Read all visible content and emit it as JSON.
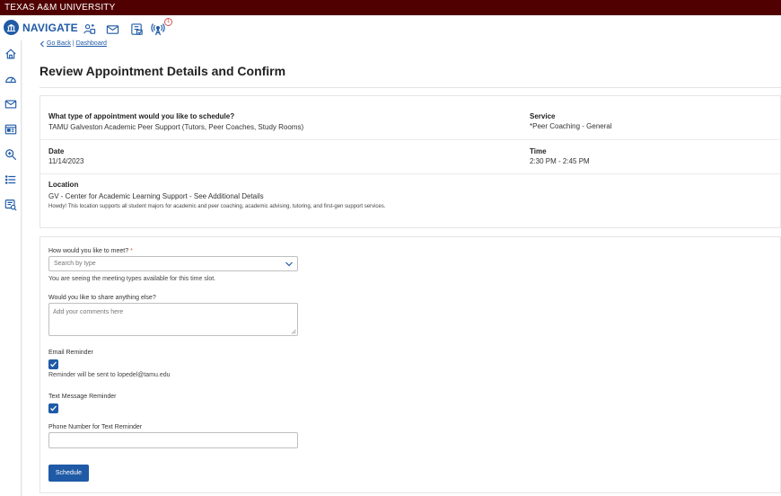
{
  "header": {
    "university": "TEXAS A&M UNIVERSITY",
    "app_name": "NAVIGATE",
    "notification_count": "1"
  },
  "breadcrumb": {
    "back": "Go Back",
    "separator": "|",
    "current": "Dashboard"
  },
  "page": {
    "title": "Review Appointment Details and Confirm"
  },
  "details": {
    "type_label": "What type of appointment would you like to schedule?",
    "type_value": "TAMU Galveston Academic Peer Support (Tutors, Peer Coaches, Study Rooms)",
    "service_label": "Service",
    "service_value": "*Peer Coaching - General",
    "date_label": "Date",
    "date_value": "11/14/2023",
    "time_label": "Time",
    "time_value": "2:30 PM - 2:45 PM",
    "location_label": "Location",
    "location_value": "GV - Center for Academic Learning Support - See Additional Details",
    "location_note": "Howdy! This location supports all student majors for academic and peer coaching, academic advising, tutoring, and first-gen support services."
  },
  "form": {
    "meet_label": "How would you like to meet?",
    "required_mark": "*",
    "meet_placeholder": "Search by type",
    "meet_help": "You are seeing the meeting types available for this time slot.",
    "comments_label": "Would you like to share anything else?",
    "comments_placeholder": "Add your comments here",
    "email_reminder_label": "Email Reminder",
    "email_reminder_note": "Reminder will be sent to lopedel@tamu.edu",
    "text_reminder_label": "Text Message Reminder",
    "phone_label": "Phone Number for Text Reminder",
    "phone_value": "",
    "submit_label": "Schedule"
  },
  "colors": {
    "maroon": "#500000",
    "primary": "#1f5aa6",
    "required": "#d9534f"
  },
  "icons": {
    "nav": [
      "students-icon",
      "mail-icon",
      "appointments-icon",
      "broadcast-icon"
    ],
    "sidebar": [
      "home-icon",
      "dashboard-icon",
      "messages-icon",
      "calendar-icon",
      "search-icon",
      "list-icon",
      "reports-icon"
    ]
  }
}
